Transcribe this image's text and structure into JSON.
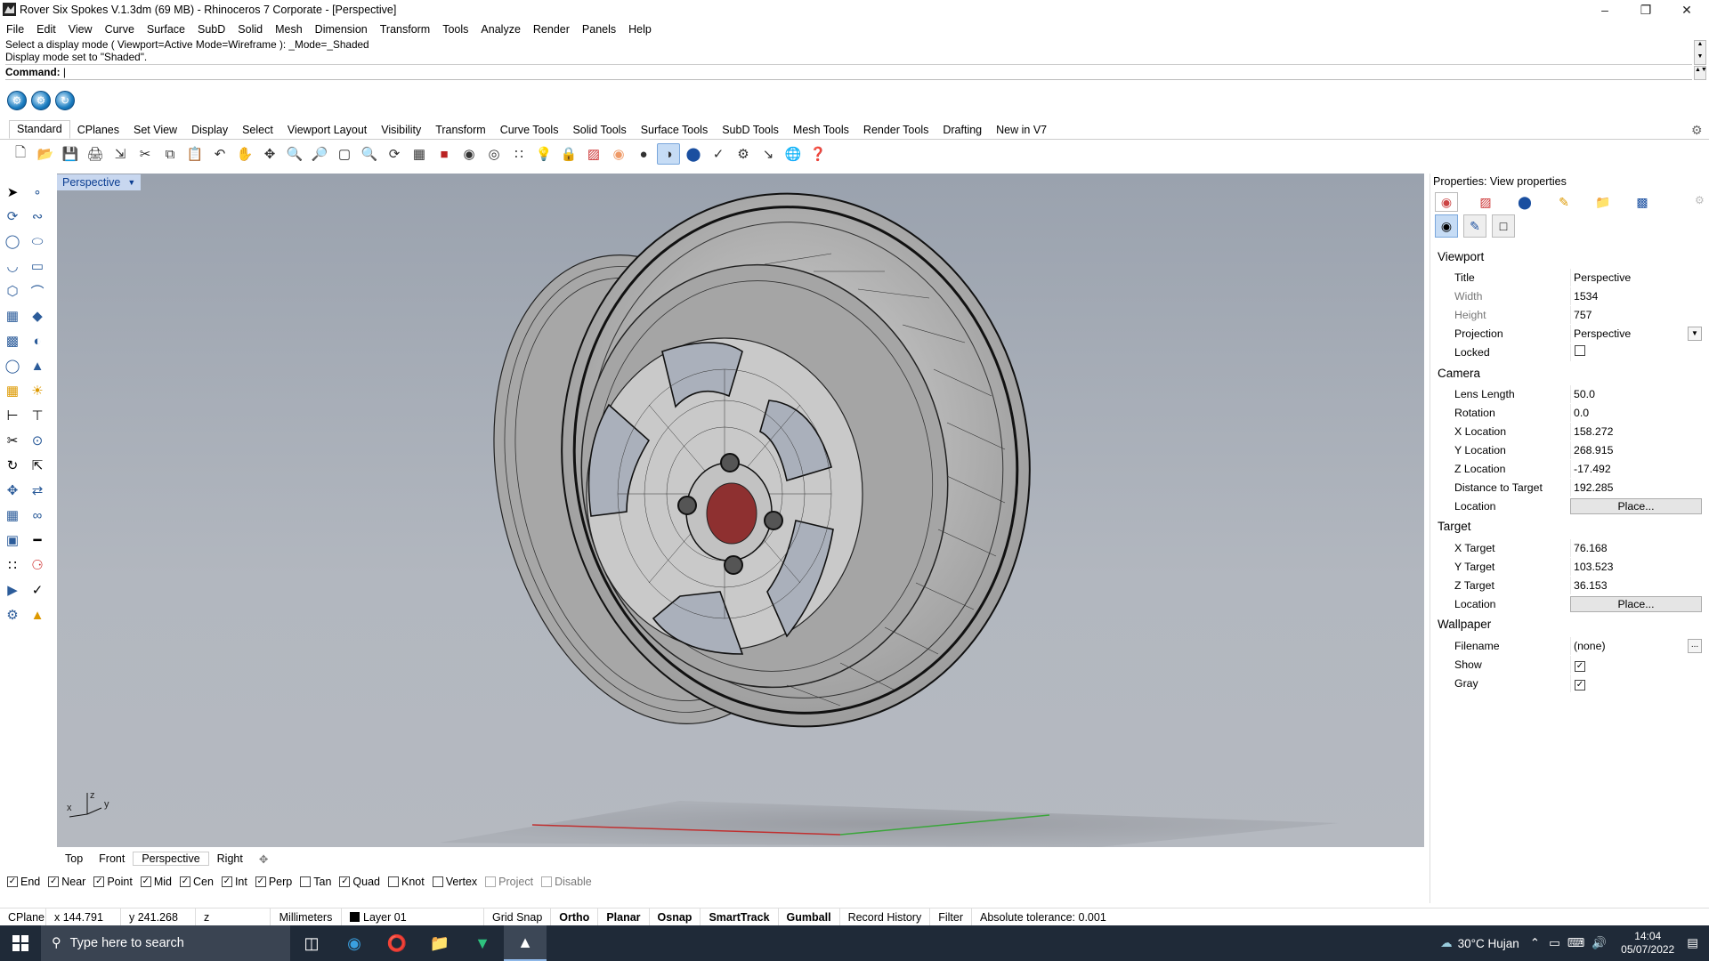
{
  "window": {
    "title": "Rover Six Spokes V.1.3dm (69 MB) - Rhinoceros 7 Corporate - [Perspective]"
  },
  "menu": [
    "File",
    "Edit",
    "View",
    "Curve",
    "Surface",
    "SubD",
    "Solid",
    "Mesh",
    "Dimension",
    "Transform",
    "Tools",
    "Analyze",
    "Render",
    "Panels",
    "Help"
  ],
  "command": {
    "history_1": "Select a display mode ( Viewport=Active  Mode=Wireframe ): _Mode=_Shaded",
    "history_2": "Display mode set to \"Shaded\".",
    "prompt": "Command:"
  },
  "toolbar_tabs": [
    "Standard",
    "CPlanes",
    "Set View",
    "Display",
    "Select",
    "Viewport Layout",
    "Visibility",
    "Transform",
    "Curve Tools",
    "Solid Tools",
    "Surface Tools",
    "SubD Tools",
    "Mesh Tools",
    "Render Tools",
    "Drafting",
    "New in V7"
  ],
  "viewport": {
    "title": "Perspective",
    "axis_x": "x",
    "axis_y": "y",
    "axis_z": "z"
  },
  "viewport_tabs": [
    "Top",
    "Front",
    "Perspective",
    "Right"
  ],
  "osnaps": [
    {
      "label": "End",
      "checked": true,
      "enabled": true
    },
    {
      "label": "Near",
      "checked": true,
      "enabled": true
    },
    {
      "label": "Point",
      "checked": true,
      "enabled": true
    },
    {
      "label": "Mid",
      "checked": true,
      "enabled": true
    },
    {
      "label": "Cen",
      "checked": true,
      "enabled": true
    },
    {
      "label": "Int",
      "checked": true,
      "enabled": true
    },
    {
      "label": "Perp",
      "checked": true,
      "enabled": true
    },
    {
      "label": "Tan",
      "checked": false,
      "enabled": true
    },
    {
      "label": "Quad",
      "checked": true,
      "enabled": true
    },
    {
      "label": "Knot",
      "checked": false,
      "enabled": true
    },
    {
      "label": "Vertex",
      "checked": false,
      "enabled": true
    },
    {
      "label": "Project",
      "checked": false,
      "enabled": false
    },
    {
      "label": "Disable",
      "checked": false,
      "enabled": false
    }
  ],
  "status": {
    "cplane": "CPlane",
    "x": "x 144.791",
    "y": "y 241.268",
    "z": "z",
    "units": "Millimeters",
    "layer": "Layer 01",
    "grid_snap": "Grid Snap",
    "ortho": "Ortho",
    "planar": "Planar",
    "osnap": "Osnap",
    "smarttrack": "SmartTrack",
    "gumball": "Gumball",
    "record_history": "Record History",
    "filter": "Filter",
    "tolerance": "Absolute tolerance: 0.001"
  },
  "properties": {
    "title": "Properties: View properties",
    "viewport_section": "Viewport",
    "title_label": "Title",
    "title_value": "Perspective",
    "width_label": "Width",
    "width_value": "1534",
    "height_label": "Height",
    "height_value": "757",
    "projection_label": "Projection",
    "projection_value": "Perspective",
    "locked_label": "Locked",
    "locked": false,
    "camera_section": "Camera",
    "lens_label": "Lens Length",
    "lens_value": "50.0",
    "rotation_label": "Rotation",
    "rotation_value": "0.0",
    "xloc_label": "X Location",
    "xloc_value": "158.272",
    "yloc_label": "Y Location",
    "yloc_value": "268.915",
    "zloc_label": "Z Location",
    "zloc_value": "-17.492",
    "dist_label": "Distance to Target",
    "dist_value": "192.285",
    "cam_location_label": "Location",
    "place_button": "Place...",
    "target_section": "Target",
    "xt_label": "X Target",
    "xt_value": "76.168",
    "yt_label": "Y Target",
    "yt_value": "103.523",
    "zt_label": "Z Target",
    "zt_value": "36.153",
    "target_location_label": "Location",
    "wallpaper_section": "Wallpaper",
    "filename_label": "Filename",
    "filename_value": "(none)",
    "show_label": "Show",
    "show": true,
    "gray_label": "Gray",
    "gray": true,
    "browse": "..."
  },
  "taskbar": {
    "search_placeholder": "Type here to search",
    "weather": "30°C  Hujan",
    "time": "14:04",
    "date": "05/07/2022"
  }
}
